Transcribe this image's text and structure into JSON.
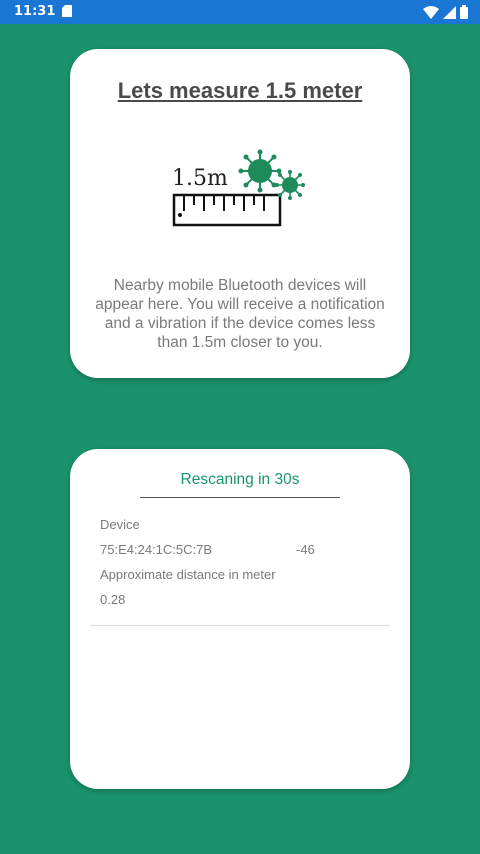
{
  "status_bar": {
    "time": "11:31",
    "icons": [
      "sd-card-icon",
      "wifi-icon",
      "cellular-signal-icon",
      "battery-icon"
    ]
  },
  "header_card": {
    "title": "Lets measure 1.5 meter",
    "illustration_label": "1.5m",
    "description": "Nearby mobile Bluetooth devices will appear here. You will receive a notification and a vibration if the device comes less than 1.5m closer to you."
  },
  "device_card": {
    "rescan_text": "Rescaning in 30s",
    "devices": [
      {
        "label": "Device",
        "address": "75:E4:24:1C:5C:7B",
        "rssi": "-46",
        "distance_label": "Approximate distance in meter",
        "distance": "0.28"
      }
    ]
  },
  "colors": {
    "background": "#1a936c",
    "status_bar": "#1976d2",
    "accent": "#1a936c",
    "virus": "#1e8c5a"
  }
}
